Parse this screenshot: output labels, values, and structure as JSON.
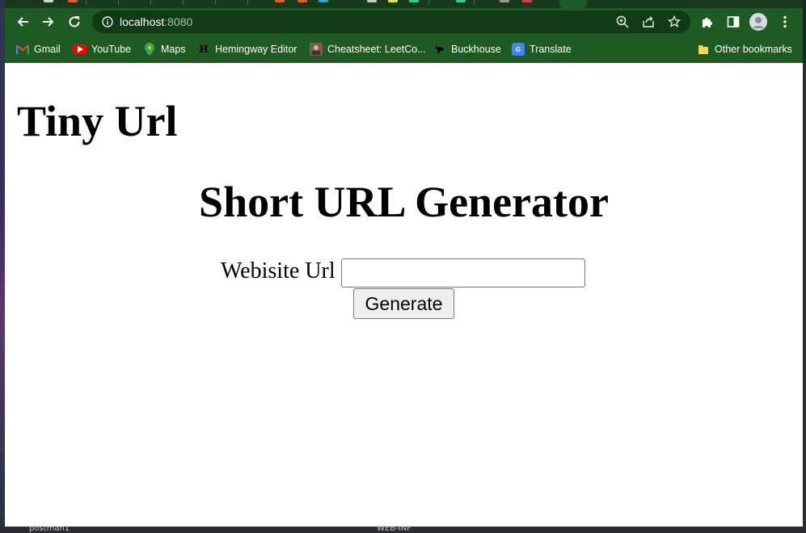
{
  "browser": {
    "url_host": "localhost",
    "url_port": ":8080",
    "accent_color": "#1f5a24",
    "bookmarks": [
      {
        "label": "Gmail",
        "icon": "gmail-icon"
      },
      {
        "label": "YouTube",
        "icon": "youtube-icon"
      },
      {
        "label": "Maps",
        "icon": "maps-icon"
      },
      {
        "label": "Hemingway Editor",
        "icon": "hemingway-icon"
      },
      {
        "label": "Cheatsheet: LeetCo...",
        "icon": "profile-photo-icon"
      },
      {
        "label": "Buckhouse",
        "icon": "buckhouse-icon"
      },
      {
        "label": "Translate",
        "icon": "translate-icon"
      }
    ],
    "other_bookmarks": "Other bookmarks"
  },
  "page": {
    "title": "Tiny Url",
    "heading": "Short URL Generator",
    "form": {
      "label": "Webisite Url",
      "input_value": "",
      "button_label": "Generate"
    }
  },
  "desktop": {
    "bottom_labels": [
      "postman1",
      "WEB-INF"
    ]
  }
}
